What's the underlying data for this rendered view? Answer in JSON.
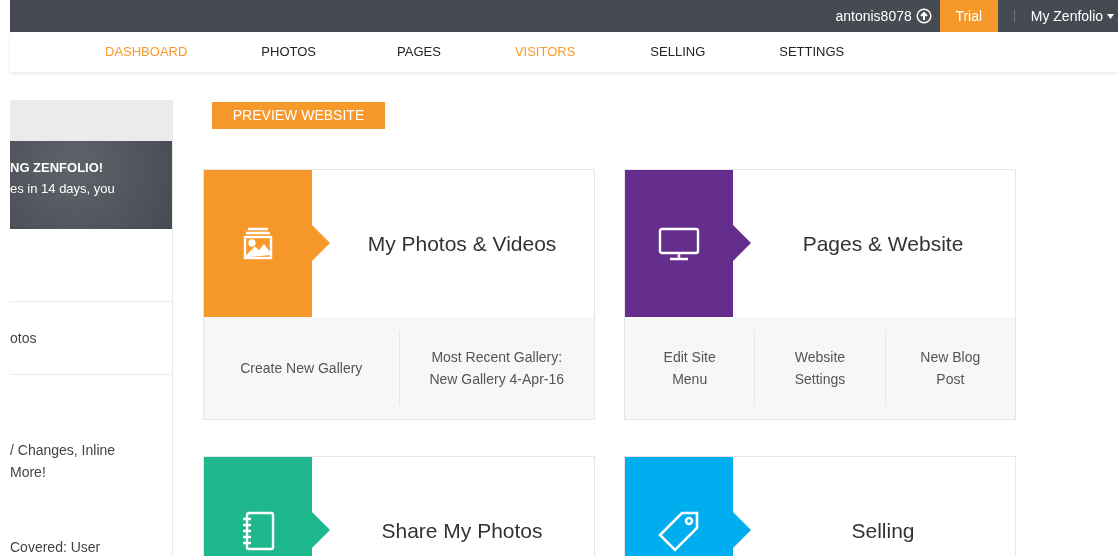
{
  "top_bar": {
    "username": "antonis8078",
    "trial_button": "Trial",
    "account_menu": "My Zenfolio"
  },
  "nav": [
    {
      "label": "DASHBOARD",
      "highlighted": true
    },
    {
      "label": "PHOTOS",
      "highlighted": false
    },
    {
      "label": "PAGES",
      "highlighted": false
    },
    {
      "label": "VISITORS",
      "highlighted": true
    },
    {
      "label": "SELLING",
      "highlighted": false
    },
    {
      "label": "SETTINGS",
      "highlighted": false
    }
  ],
  "sidebar": {
    "banner_lines": [
      "NG ZENFOLIO!",
      "es in 14 days, you"
    ],
    "item": "otos",
    "news_lines": [
      "/ Changes, Inline",
      "More!"
    ],
    "footer_line": "Covered: User"
  },
  "preview_button": "PREVIEW WEBSITE",
  "cards": [
    {
      "title": "My Photos & Videos",
      "color": "#f7992a",
      "links": [
        "Create New Gallery",
        "Most Recent Gallery:\nNew Gallery 4-Apr-16"
      ]
    },
    {
      "title": "Pages & Website",
      "color": "#652d8c",
      "links": [
        "Edit Site\nMenu",
        "Website\nSettings",
        "New Blog\nPost"
      ]
    },
    {
      "title": "Share My Photos",
      "color": "#1fb78e"
    },
    {
      "title": "Selling",
      "color": "#00aeef"
    }
  ]
}
